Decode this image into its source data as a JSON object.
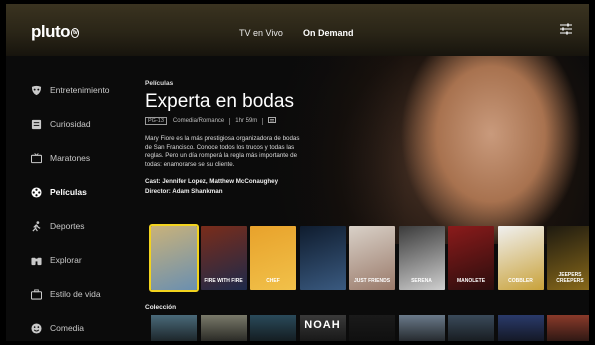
{
  "header": {
    "logo_text": "pluto",
    "logo_badge": "tv",
    "nav": [
      {
        "label": "TV en Vivo",
        "active": false
      },
      {
        "label": "On Demand",
        "active": true
      }
    ],
    "settings_icon": "sliders-icon"
  },
  "sidebar": {
    "items": [
      {
        "label": "Entretenimiento",
        "icon": "drama-masks-icon",
        "active": false
      },
      {
        "label": "Curiosidad",
        "icon": "book-icon",
        "active": false
      },
      {
        "label": "Maratones",
        "icon": "tv-icon",
        "active": false
      },
      {
        "label": "Películas",
        "icon": "film-reel-icon",
        "active": true
      },
      {
        "label": "Deportes",
        "icon": "runner-icon",
        "active": false
      },
      {
        "label": "Explorar",
        "icon": "binoculars-icon",
        "active": false
      },
      {
        "label": "Estilo de vida",
        "icon": "briefcase-icon",
        "active": false
      },
      {
        "label": "Comedia",
        "icon": "smiley-icon",
        "active": false
      }
    ]
  },
  "hero": {
    "category": "Películas",
    "title": "Experta en bodas",
    "rating": "PG-13",
    "genre": "Comedia/Romance",
    "duration": "1hr 59m",
    "cc_icon": "closed-captions-icon",
    "description": "Mary Fiore es la más prestigiosa organizadora de bodas de San Francisco. Conoce todos los trucos y todas las reglas. Pero un día romperá la regla más importante de todas: enamorarse se su cliente.",
    "cast": "Cast: Jennifer Lopez, Matthew McConaughey",
    "director": "Director: Adam Shankman"
  },
  "posters": [
    {
      "label": "",
      "color_a": "#c9b27a",
      "color_b": "#6a8fb0",
      "selected": true
    },
    {
      "label": "FIRE WITH FIRE",
      "color_a": "#7a2c1a",
      "color_b": "#1d2a4a",
      "selected": false
    },
    {
      "label": "CHEF",
      "color_a": "#e8a22b",
      "color_b": "#f1c14a",
      "selected": false
    },
    {
      "label": "",
      "color_a": "#0f1c2e",
      "color_b": "#3a5a80",
      "selected": false
    },
    {
      "label": "JUST FRIENDS",
      "color_a": "#d9d1c8",
      "color_b": "#9a7a6a",
      "selected": false
    },
    {
      "label": "SERENA",
      "color_a": "#3b3b3b",
      "color_b": "#cfcfcf",
      "selected": false
    },
    {
      "label": "MANOLETE",
      "color_a": "#8b1b1b",
      "color_b": "#2a0d0d",
      "selected": false
    },
    {
      "label": "COBBLER",
      "color_a": "#f0f0f0",
      "color_b": "#c9a23a",
      "selected": false
    },
    {
      "label": "JEEPERS CREEPERS",
      "color_a": "#1e1a10",
      "color_b": "#8a6a1a",
      "selected": false
    }
  ],
  "collection": {
    "label": "Colección",
    "thumbs": [
      {
        "text": "",
        "color": "#4a6a7a"
      },
      {
        "text": "",
        "color": "#7a7a6a"
      },
      {
        "text": "",
        "color": "#2a4a5a"
      },
      {
        "text": "NOAH",
        "color": "#3a3a3a"
      },
      {
        "text": "",
        "color": "#1a1a1a"
      },
      {
        "text": "",
        "color": "#6a7a8a"
      },
      {
        "text": "",
        "color": "#3a4a5a"
      },
      {
        "text": "",
        "color": "#2a3a6a"
      },
      {
        "text": "",
        "color": "#8a3a2a"
      }
    ]
  }
}
